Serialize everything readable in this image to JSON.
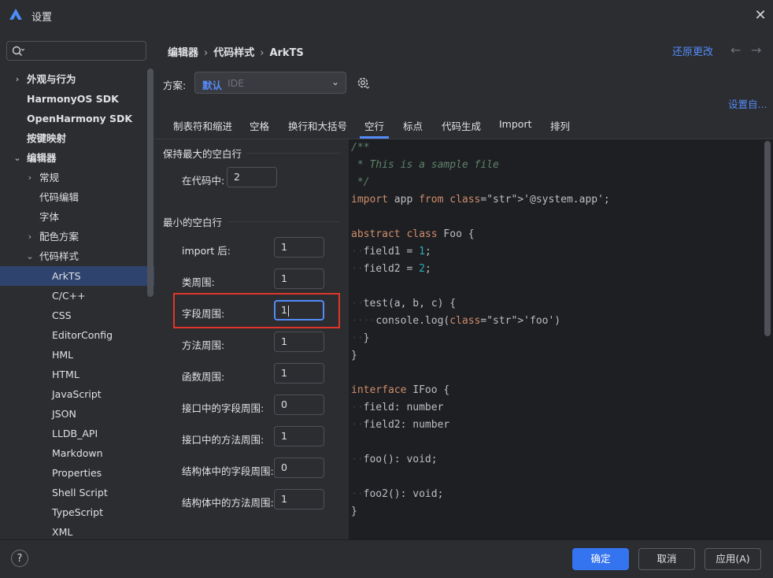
{
  "window": {
    "title": "设置",
    "close_icon": "close-icon",
    "logo_icon": "app-logo-icon"
  },
  "sidebar": {
    "search_placeholder": "",
    "items": [
      {
        "label": "外观与行为",
        "chevron": "›"
      },
      {
        "label": "HarmonyOS SDK",
        "chevron": ""
      },
      {
        "label": "OpenHarmony SDK",
        "chevron": ""
      },
      {
        "label": "按键映射",
        "chevron": ""
      },
      {
        "label": "编辑器",
        "chevron": "⌄"
      },
      {
        "label": "常规",
        "chevron": "›"
      },
      {
        "label": "代码编辑",
        "chevron": ""
      },
      {
        "label": "字体",
        "chevron": ""
      },
      {
        "label": "配色方案",
        "chevron": "›"
      },
      {
        "label": "代码样式",
        "chevron": "⌄"
      },
      {
        "label": "ArkTS",
        "chevron": ""
      },
      {
        "label": "C/C++",
        "chevron": ""
      },
      {
        "label": "CSS",
        "chevron": ""
      },
      {
        "label": "EditorConfig",
        "chevron": ""
      },
      {
        "label": "HML",
        "chevron": ""
      },
      {
        "label": "HTML",
        "chevron": ""
      },
      {
        "label": "JavaScript",
        "chevron": ""
      },
      {
        "label": "JSON",
        "chevron": ""
      },
      {
        "label": "LLDB_API",
        "chevron": ""
      },
      {
        "label": "Markdown",
        "chevron": ""
      },
      {
        "label": "Properties",
        "chevron": ""
      },
      {
        "label": "Shell Script",
        "chevron": ""
      },
      {
        "label": "TypeScript",
        "chevron": ""
      },
      {
        "label": "XML",
        "chevron": ""
      }
    ]
  },
  "header": {
    "breadcrumb": [
      "编辑器",
      "代码样式",
      "ArkTS"
    ],
    "breadcrumb_sep": "›",
    "revert_label": "还原更改",
    "back_arrow": "←",
    "forward_arrow": "→"
  },
  "scheme": {
    "label": "方案:",
    "value_primary": "默认",
    "value_secondary": "IDE",
    "dropdown_glyph": "⌄",
    "setup_link": "设置自..."
  },
  "tabs": [
    "制表符和缩进",
    "空格",
    "换行和大括号",
    "空行",
    "标点",
    "代码生成",
    "Import",
    "排列"
  ],
  "active_tab": "空行",
  "keep_section": {
    "title": "保持最大的空白行",
    "rows": [
      {
        "label": "在代码中:",
        "value": "2"
      }
    ]
  },
  "min_section": {
    "title": "最小的空白行",
    "rows": [
      {
        "label": "import 后:",
        "value": "1"
      },
      {
        "label": "类周围:",
        "value": "1"
      },
      {
        "label": "字段周围:",
        "value": "1"
      },
      {
        "label": "方法周围:",
        "value": "1"
      },
      {
        "label": "函数周围:",
        "value": "1"
      },
      {
        "label": "接口中的字段周围:",
        "value": "0"
      },
      {
        "label": "接口中的方法周围:",
        "value": "1"
      },
      {
        "label": "结构体中的字段周围:",
        "value": "0"
      },
      {
        "label": "结构体中的方法周围:",
        "value": "1"
      }
    ]
  },
  "code_sample": [
    "/**",
    " * This is a sample file",
    " */",
    "import app from '@system.app';",
    "",
    "abstract class Foo {",
    "  field1 = 1;",
    "  field2 = 2;",
    "",
    "  test(a, b, c) {",
    "    console.log('foo')",
    "  }",
    "}",
    "",
    "interface IFoo {",
    "  field: number",
    "  field2: number",
    "",
    "  foo(): void;",
    "",
    "  foo2(): void;",
    "}"
  ],
  "footer": {
    "help_label": "?",
    "ok_label": "确定",
    "cancel_label": "取消",
    "apply_label": "应用(A)"
  },
  "colors": {
    "accent": "#548af7",
    "primary_button": "#3574f0",
    "selection": "#2e436e",
    "highlight_border": "#e0352b"
  }
}
